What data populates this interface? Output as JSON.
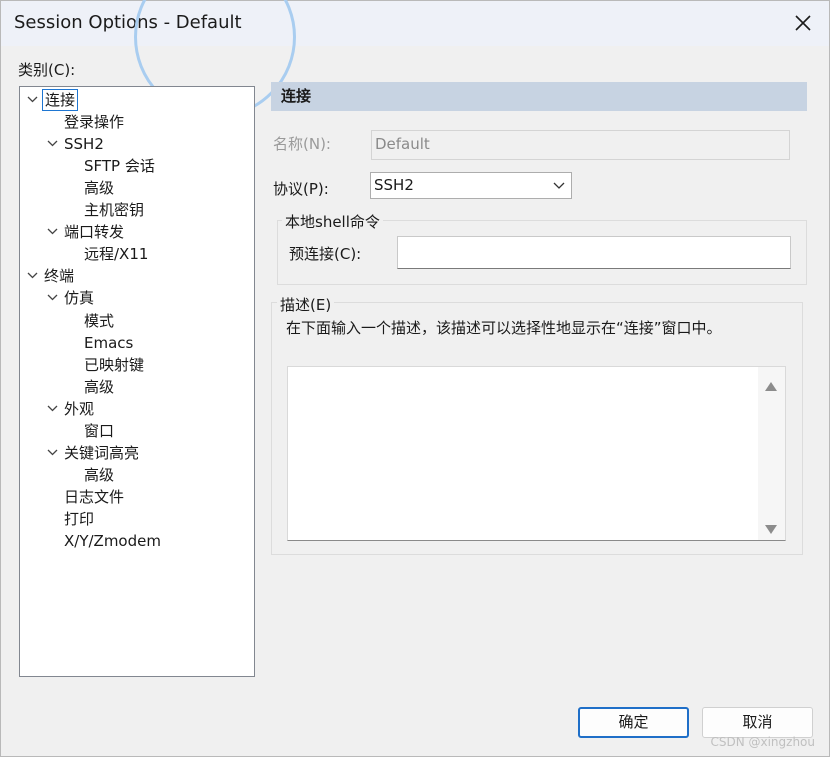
{
  "window": {
    "title": "Session Options - Default",
    "close_icon": "close-icon"
  },
  "category_label": "类别(C):",
  "tree": [
    {
      "label": "连接",
      "level": 0,
      "expanded": true,
      "selected": true
    },
    {
      "label": "登录操作",
      "level": 1
    },
    {
      "label": "SSH2",
      "level": 1,
      "expanded": true
    },
    {
      "label": "SFTP 会话",
      "level": 2
    },
    {
      "label": "高级",
      "level": 2
    },
    {
      "label": "主机密钥",
      "level": 2
    },
    {
      "label": "端口转发",
      "level": 1,
      "expanded": true
    },
    {
      "label": "远程/X11",
      "level": 2
    },
    {
      "label": "终端",
      "level": 0,
      "expanded": true
    },
    {
      "label": "仿真",
      "level": 1,
      "expanded": true
    },
    {
      "label": "模式",
      "level": 2
    },
    {
      "label": "Emacs",
      "level": 2
    },
    {
      "label": "已映射键",
      "level": 2
    },
    {
      "label": "高级",
      "level": 2
    },
    {
      "label": "外观",
      "level": 1,
      "expanded": true
    },
    {
      "label": "窗口",
      "level": 2
    },
    {
      "label": "关键词高亮",
      "level": 1,
      "expanded": true
    },
    {
      "label": "高级",
      "level": 2
    },
    {
      "label": "日志文件",
      "level": 1
    },
    {
      "label": "打印",
      "level": 1
    },
    {
      "label": "X/Y/Zmodem",
      "level": 1
    }
  ],
  "panel": {
    "header": "连接",
    "name_label": "名称(N):",
    "name_value": "Default",
    "protocol_label": "协议(P):",
    "protocol_value": "SSH2",
    "shell_group_title": "本地shell命令",
    "preconnect_label": "预连接(C):",
    "preconnect_value": "",
    "desc_group_title": "描述(E)",
    "desc_hint": "在下面输入一个描述，该描述可以选择性地显示在“连接”窗口中。",
    "desc_value": ""
  },
  "buttons": {
    "ok": "确定",
    "cancel": "取消"
  },
  "watermark": "CSDN @xingzhou",
  "colors": {
    "panel_header_bg": "#c7d3e2",
    "primary_border": "#1f6fc8",
    "selection_border": "#1e76d2"
  }
}
